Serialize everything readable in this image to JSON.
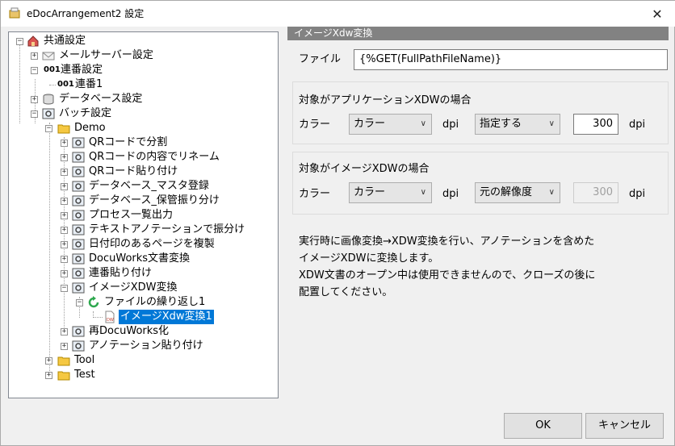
{
  "window": {
    "title": "eDocArrangement2 設定"
  },
  "tree": {
    "root": "共通設定",
    "mail": "メールサーバー設定",
    "serial": "連番設定",
    "serial_prefix": "001",
    "serial1": "連番1",
    "database": "データベース設定",
    "batch": "バッチ設定",
    "demo": "Demo",
    "items": [
      "QRコードで分割",
      "QRコードの内容でリネーム",
      "QRコード貼り付け",
      "データベース_マスタ登録",
      "データベース_保管振り分け",
      "プロセス一覧出力",
      "テキストアノテーションで振分け",
      "日付印のあるページを複製",
      "DocuWorks文書変換",
      "連番貼り付け",
      "イメージXDW変換"
    ],
    "loop": "ファイルの繰り返し1",
    "selected": "イメージXdw変換1",
    "after": [
      "再DocuWorks化",
      "アノテーション貼り付け"
    ],
    "tool": "Tool",
    "test": "Test"
  },
  "panel": {
    "header": "イメージXdw変換",
    "file_label": "ファイル",
    "file_value": "{%GET(FullPathFileName)}",
    "app_group_title": "対象がアプリケーションXDWの場合",
    "image_group_title": "対象がイメージXDWの場合",
    "color_label": "カラー",
    "dpi_label": "dpi",
    "app_color": "カラー",
    "app_dpi_mode": "指定する",
    "app_dpi_value": "300",
    "img_color": "カラー",
    "img_dpi_mode": "元の解像度",
    "img_dpi_value": "300",
    "description": [
      "実行時に画像変換→XDW変換を行い、アノテーションを含めた",
      "イメージXDWに変換します。",
      "XDW文書のオープン中は使用できませんので、クローズの後に",
      "配置してください。"
    ]
  },
  "buttons": {
    "ok": "OK",
    "cancel": "キャンセル"
  }
}
